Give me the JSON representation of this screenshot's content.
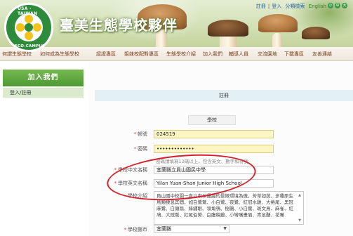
{
  "header": {
    "site_title": "臺美生態學校夥伴",
    "logo": {
      "ring_top": "USA · TAIWAN",
      "ring_bottom": "ECO-CAMPUS"
    },
    "top_links": {
      "register": "註冊",
      "login": "登入",
      "sep": "|",
      "search": "分類檢索",
      "english": "English"
    },
    "text_size_buttons": [
      "小",
      "中",
      "大"
    ]
  },
  "nav": {
    "items": [
      "何謂生態學校",
      "如何成為生態學校",
      "認證專區",
      "姐妹校配對專區",
      "生態學校介紹",
      "加入我們",
      "輔導人員",
      "交流園地",
      "下載專區",
      "友善連結"
    ]
  },
  "sidebar": {
    "heading": "加入我們",
    "items": [
      "登入/註冊"
    ]
  },
  "main": {
    "register_heading": "註冊",
    "section_label": "學校",
    "fields": {
      "account_label": "帳號",
      "account_value": "024519",
      "password_label": "密碼",
      "password_value": "•••••••••••••",
      "password_hint": "密碼請填寫12碼以上，包含英文、數字和符號",
      "school_name_zh_label": "學校中文名稱",
      "school_name_zh_value": "宜蘭縣立員山國民中學",
      "school_name_en_label": "學校英文名稱",
      "school_name_en_value": "Yilan Yuan-Shan Junior High School",
      "intro_label": "學校介紹",
      "intro_value": "員山國中校園一直以來以優越的景緻環境為傲，芳草如茵，多種原生鳥類棲息其間，如白鷺鷥、小白鷺、夜鷺、紅冠水雞、大捲尾、黑冠麻鷺、白頭翁、綠繡眼、領角鴞、樹鵲、小白鷺、斑文鳥、麻雀、紅鳩、大冠鷲、紅尾伯勞、白腹秧雞、小彎嘴畫眉、青足鷸、花嘴",
      "county_label": "學校縣市",
      "county_value": "宜蘭縣"
    }
  },
  "colors": {
    "nav_text": "#7a3c1c",
    "sidebar_heading_bg": "#4e9a34",
    "annotation_red": "#d2232a",
    "required_mark": "#d33",
    "input_highlight": "#fdf6c3"
  }
}
